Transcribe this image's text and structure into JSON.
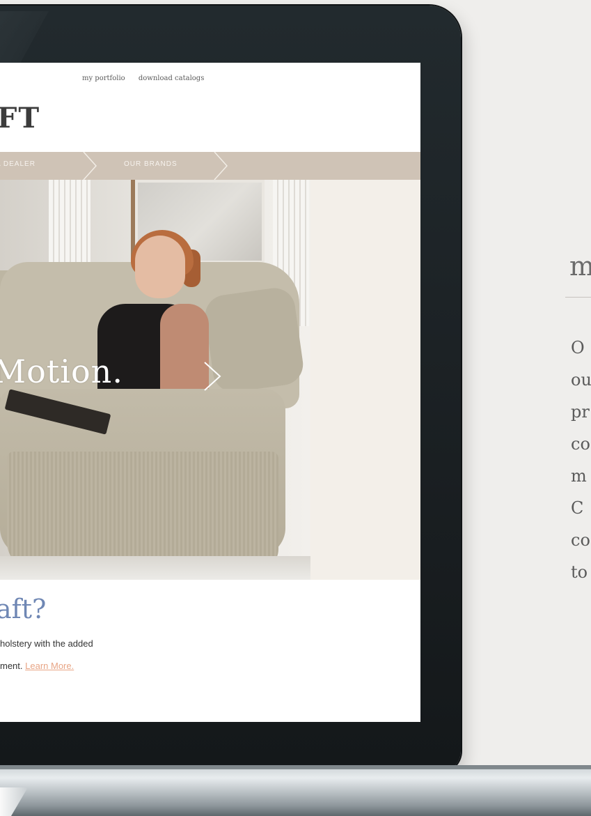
{
  "screen": {
    "util_nav": [
      "my portfolio",
      "download catalogs"
    ],
    "logo_text": "FT",
    "main_nav": [
      "A DEALER",
      "OUR BRANDS"
    ],
    "hero": {
      "title": "Motion."
    },
    "promo": {
      "heading": "aft?",
      "line1": "holstery with the added",
      "line2_prefix": "ment. ",
      "learn_more": "Learn More."
    }
  },
  "side_text": {
    "title": "m",
    "lines": [
      "O",
      "ou",
      "pr",
      "co",
      "m",
      "C",
      "co",
      "to"
    ]
  },
  "colors": {
    "nav_bar": "#cfc3b6",
    "promo_heading": "#6f87b4",
    "link": "#e8a585",
    "bezel": "#1d2326"
  }
}
